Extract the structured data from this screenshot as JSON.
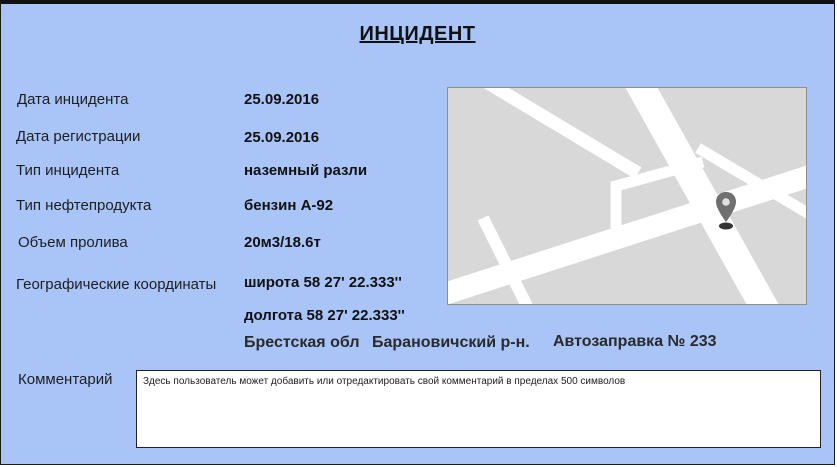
{
  "title": "ИНЦИДЕНТ",
  "fields": {
    "incident_date": {
      "label": "Дата инцидента",
      "value": "25.09.2016"
    },
    "registration_date": {
      "label": "Дата регистрации",
      "value": "25.09.2016"
    },
    "incident_type": {
      "label": "Тип инцидента",
      "value": "наземный разли"
    },
    "oil_product_type": {
      "label": "Тип нефтепродукта",
      "value": "бензин А-92"
    },
    "spill_volume": {
      "label": "Объем пролива",
      "value": "20м3/18.6т"
    },
    "coordinates": {
      "label": "Географические координаты",
      "latitude": "широта 58 27' 22.333''",
      "longitude": "долгота 58 27' 22.333''"
    }
  },
  "location": {
    "region": "Брестская обл",
    "district": "Барановичский р-н.",
    "station": "Автозаправка № 233"
  },
  "comment": {
    "label": "Комментарий",
    "value": "Здесь пользователь может добавить или отредактировать свой комментарий в пределах 500 символов"
  },
  "icons": {
    "map_marker": "map-pin-icon"
  },
  "colors": {
    "panel_bg": "#a9c5f7",
    "map_bg": "#d8d8d8",
    "road": "#ffffff",
    "marker": "#707070"
  }
}
